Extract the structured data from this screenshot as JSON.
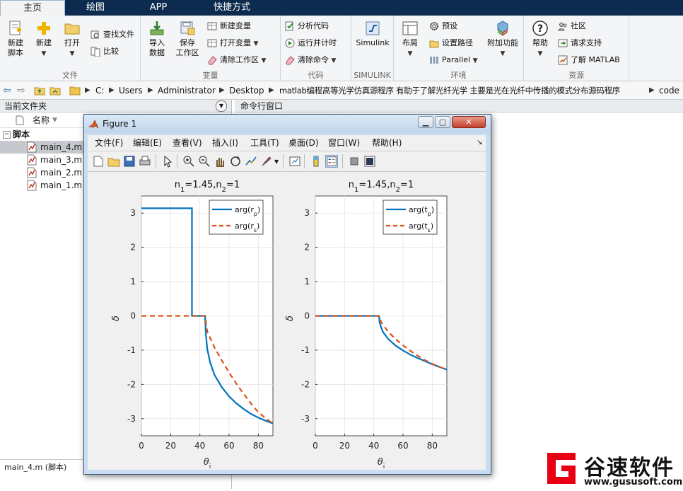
{
  "tabs": [
    {
      "label": "主页"
    },
    {
      "label": "绘图"
    },
    {
      "label": "APP"
    },
    {
      "label": "快捷方式"
    }
  ],
  "ribbon": {
    "file": {
      "group_label": "文件",
      "new_script": "新建\n脚本",
      "new_script_l1": "新建",
      "new_script_l2": "脚本",
      "new": "新建",
      "open": "打开",
      "find_files": "查找文件",
      "compare": "比较"
    },
    "variable": {
      "group_label": "变量",
      "import_l1": "导入",
      "import_l2": "数据",
      "save_l1": "保存",
      "save_l2": "工作区",
      "new_var": "新建变量",
      "open_var": "打开变量",
      "clear_ws": "清除工作区"
    },
    "code": {
      "group_label": "代码",
      "analyze": "分析代码",
      "run_time": "运行并计时",
      "clear_cmd": "清除命令"
    },
    "simulink": {
      "group_label": "SIMULINK",
      "simulink": "Simulink"
    },
    "env": {
      "group_label": "环境",
      "layout": "布局",
      "prefs": "预设",
      "set_path": "设置路径",
      "parallel": "Parallel",
      "addons": "附加功能"
    },
    "resources": {
      "group_label": "资源",
      "help": "帮助",
      "community": "社区",
      "support": "请求支持",
      "learn": "了解 MATLAB"
    }
  },
  "address": {
    "crumbs": [
      "C:",
      "Users",
      "Administrator",
      "Desktop",
      "matlab编程高等光学仿真源程序 有助于了解光纤光学 主要是光在光纤中传播的模式分布源码程序",
      "code"
    ]
  },
  "current_folder": {
    "title": "当前文件夹",
    "name_col": "名称",
    "section": "脚本",
    "files": [
      {
        "name": "main_4.m"
      },
      {
        "name": "main_3.m"
      },
      {
        "name": "main_2.m"
      },
      {
        "name": "main_1.m"
      }
    ],
    "details": "main_4.m  (脚本)"
  },
  "command_window": {
    "title": "命令行窗口"
  },
  "figure": {
    "title": "Figure 1",
    "menu": [
      "文件(F)",
      "编辑(E)",
      "查看(V)",
      "插入(I)",
      "工具(T)",
      "桌面(D)",
      "窗口(W)",
      "帮助(H)"
    ]
  },
  "chart_data": [
    {
      "type": "line",
      "title": "n1=1.45,n2=1",
      "title_n1_base": "n",
      "title_n1_sub": "1",
      "title_n1_val": "=1.45,n",
      "title_n2_sub": "2",
      "title_n2_val": "=1",
      "xlabel": "θi",
      "ylabel": "δ",
      "xlim": [
        0,
        90
      ],
      "ylim": [
        -3.5,
        3.5
      ],
      "xticks": [
        0,
        20,
        40,
        60,
        80
      ],
      "yticks": [
        -3,
        -2,
        -1,
        0,
        1,
        2,
        3
      ],
      "legend_position": "top-right",
      "series": [
        {
          "name": "arg(rp)",
          "color": "#0072bd",
          "style": "solid",
          "x": [
            0,
            34.6,
            34.6,
            43.6,
            44,
            45,
            47,
            50,
            55,
            60,
            65,
            70,
            75,
            80,
            85,
            90
          ],
          "y": [
            3.14,
            3.14,
            0,
            0,
            -0.45,
            -0.95,
            -1.35,
            -1.72,
            -2.08,
            -2.35,
            -2.55,
            -2.72,
            -2.86,
            -2.97,
            -3.06,
            -3.14
          ]
        },
        {
          "name": "arg(rs)",
          "color": "#d95319",
          "style": "dashed",
          "x": [
            0,
            10,
            20,
            30,
            40,
            43.6,
            45,
            50,
            55,
            60,
            65,
            70,
            75,
            80,
            85,
            90
          ],
          "y": [
            0,
            0,
            0,
            0,
            0,
            0,
            -0.45,
            -0.92,
            -1.3,
            -1.65,
            -1.98,
            -2.28,
            -2.56,
            -2.81,
            -2.99,
            -3.14
          ]
        }
      ]
    },
    {
      "type": "line",
      "title": "n1=1.45,n2=1",
      "xlabel": "θi",
      "ylabel": "δ",
      "xlim": [
        0,
        90
      ],
      "ylim": [
        -3.5,
        3.5
      ],
      "xticks": [
        0,
        20,
        40,
        60,
        80
      ],
      "yticks": [
        -3,
        -2,
        -1,
        0,
        1,
        2,
        3
      ],
      "legend_position": "top-right",
      "series": [
        {
          "name": "arg(tp)",
          "color": "#0072bd",
          "style": "solid",
          "x": [
            0,
            10,
            20,
            30,
            40,
            43.6,
            44,
            46,
            50,
            55,
            60,
            65,
            70,
            75,
            80,
            85,
            90
          ],
          "y": [
            0,
            0,
            0,
            0,
            0,
            0,
            -0.2,
            -0.45,
            -0.68,
            -0.87,
            -1.01,
            -1.13,
            -1.23,
            -1.32,
            -1.41,
            -1.49,
            -1.57
          ]
        },
        {
          "name": "arg(ts)",
          "color": "#d95319",
          "style": "dashed",
          "x": [
            0,
            10,
            20,
            30,
            40,
            43.6,
            45,
            50,
            55,
            60,
            65,
            70,
            75,
            80,
            85,
            90
          ],
          "y": [
            0,
            0,
            0,
            0,
            0,
            0,
            -0.18,
            -0.47,
            -0.68,
            -0.86,
            -1.02,
            -1.16,
            -1.29,
            -1.4,
            -1.49,
            -1.57
          ]
        }
      ]
    }
  ],
  "logo": {
    "brand": "谷速软件",
    "url": "www.gususoft.com",
    "mark_color": "#e60012"
  }
}
